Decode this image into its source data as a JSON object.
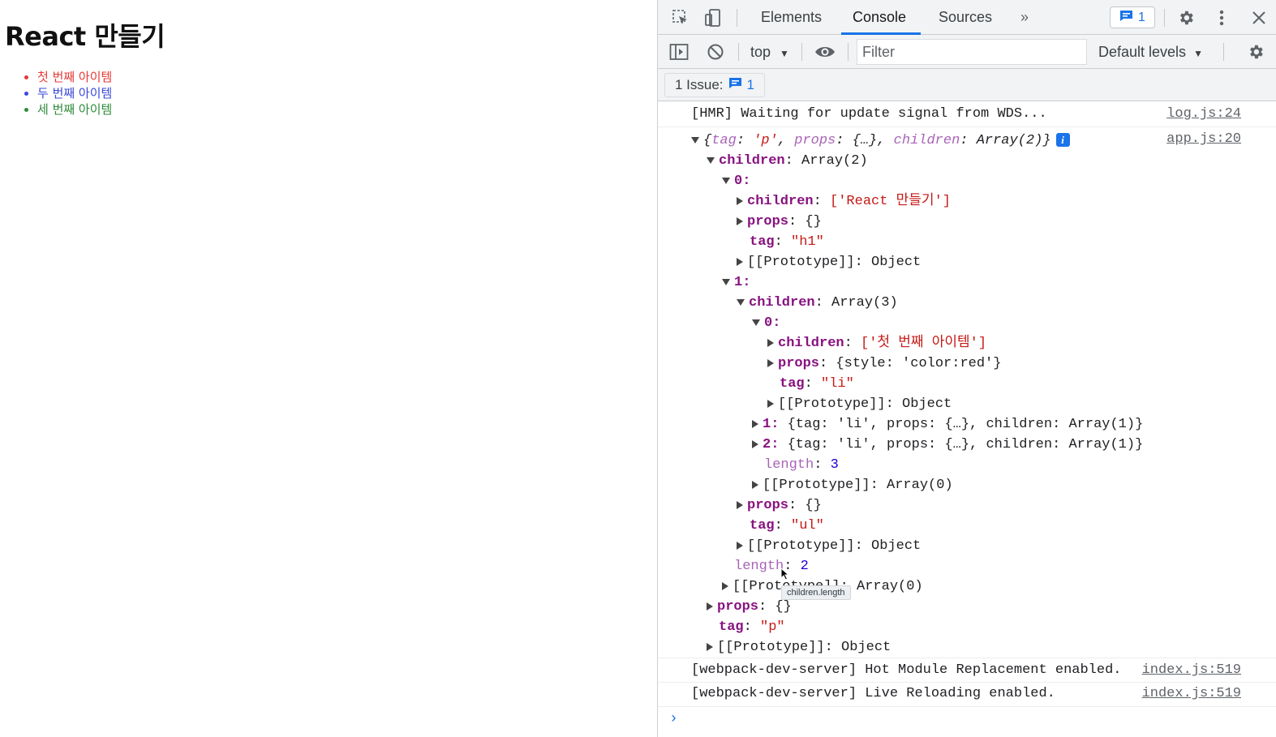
{
  "page": {
    "heading": "React 만들기",
    "items": [
      {
        "text": "첫 번째 아이템",
        "color": "#e53935"
      },
      {
        "text": "두 번째 아이템",
        "color": "#3949d8"
      },
      {
        "text": "세 번째 아이템",
        "color": "#2e8b3a"
      }
    ]
  },
  "devtools": {
    "tabs": [
      "Elements",
      "Console",
      "Sources"
    ],
    "active_tab": "Console",
    "more_tabs": "»",
    "issues_count": "1",
    "toolbar": {
      "context": "top",
      "filter_placeholder": "Filter",
      "levels": "Default levels"
    },
    "issues_bar": {
      "label": "1 Issue:",
      "count": "1"
    },
    "accent": "#1a73e8"
  },
  "console": {
    "messages": [
      {
        "text": "[HMR] Waiting for update signal from WDS...",
        "source": "log.js:24"
      },
      {
        "text": "[webpack-dev-server] Hot Module Replacement enabled.",
        "source": "index.js:519"
      },
      {
        "text": "[webpack-dev-server] Live Reloading enabled.",
        "source": "index.js:519"
      }
    ],
    "object_summary": {
      "open": "{",
      "tag_key": "tag",
      "tag_val": "'p'",
      "props_key": "props",
      "props_val": "{…}",
      "children_key": "children",
      "children_val": "Array(2)",
      "close": "}",
      "source": "app.js:20"
    },
    "tree": {
      "children_key": "children",
      "children_arr2": "Array(2)",
      "idx0": "0",
      "idx1": "0",
      "idx_one": "1",
      "idx_two": "2",
      "h1_children_val": "['React 만들기']",
      "props_key": "props",
      "empty_obj": "{}",
      "tag_key": "tag",
      "h1_tag": "\"h1\"",
      "proto_key": "[[Prototype]]",
      "object": "Object",
      "children_arr3": "Array(3)",
      "li0_children_val": "['첫 번째 아이템']",
      "li0_props_val": "{style: 'color:red'}",
      "li_tag": "\"li\"",
      "li1_summary": "{tag: 'li', props: {…}, children: Array(1)}",
      "li2_summary": "{tag: 'li', props: {…}, children: Array(1)}",
      "length_key": "length",
      "len3": "3",
      "len2": "2",
      "array0": "Array(0)",
      "ul_tag": "\"ul\"",
      "p_tag": "\"p\""
    },
    "tooltip": "children.length",
    "prompt": "›"
  }
}
